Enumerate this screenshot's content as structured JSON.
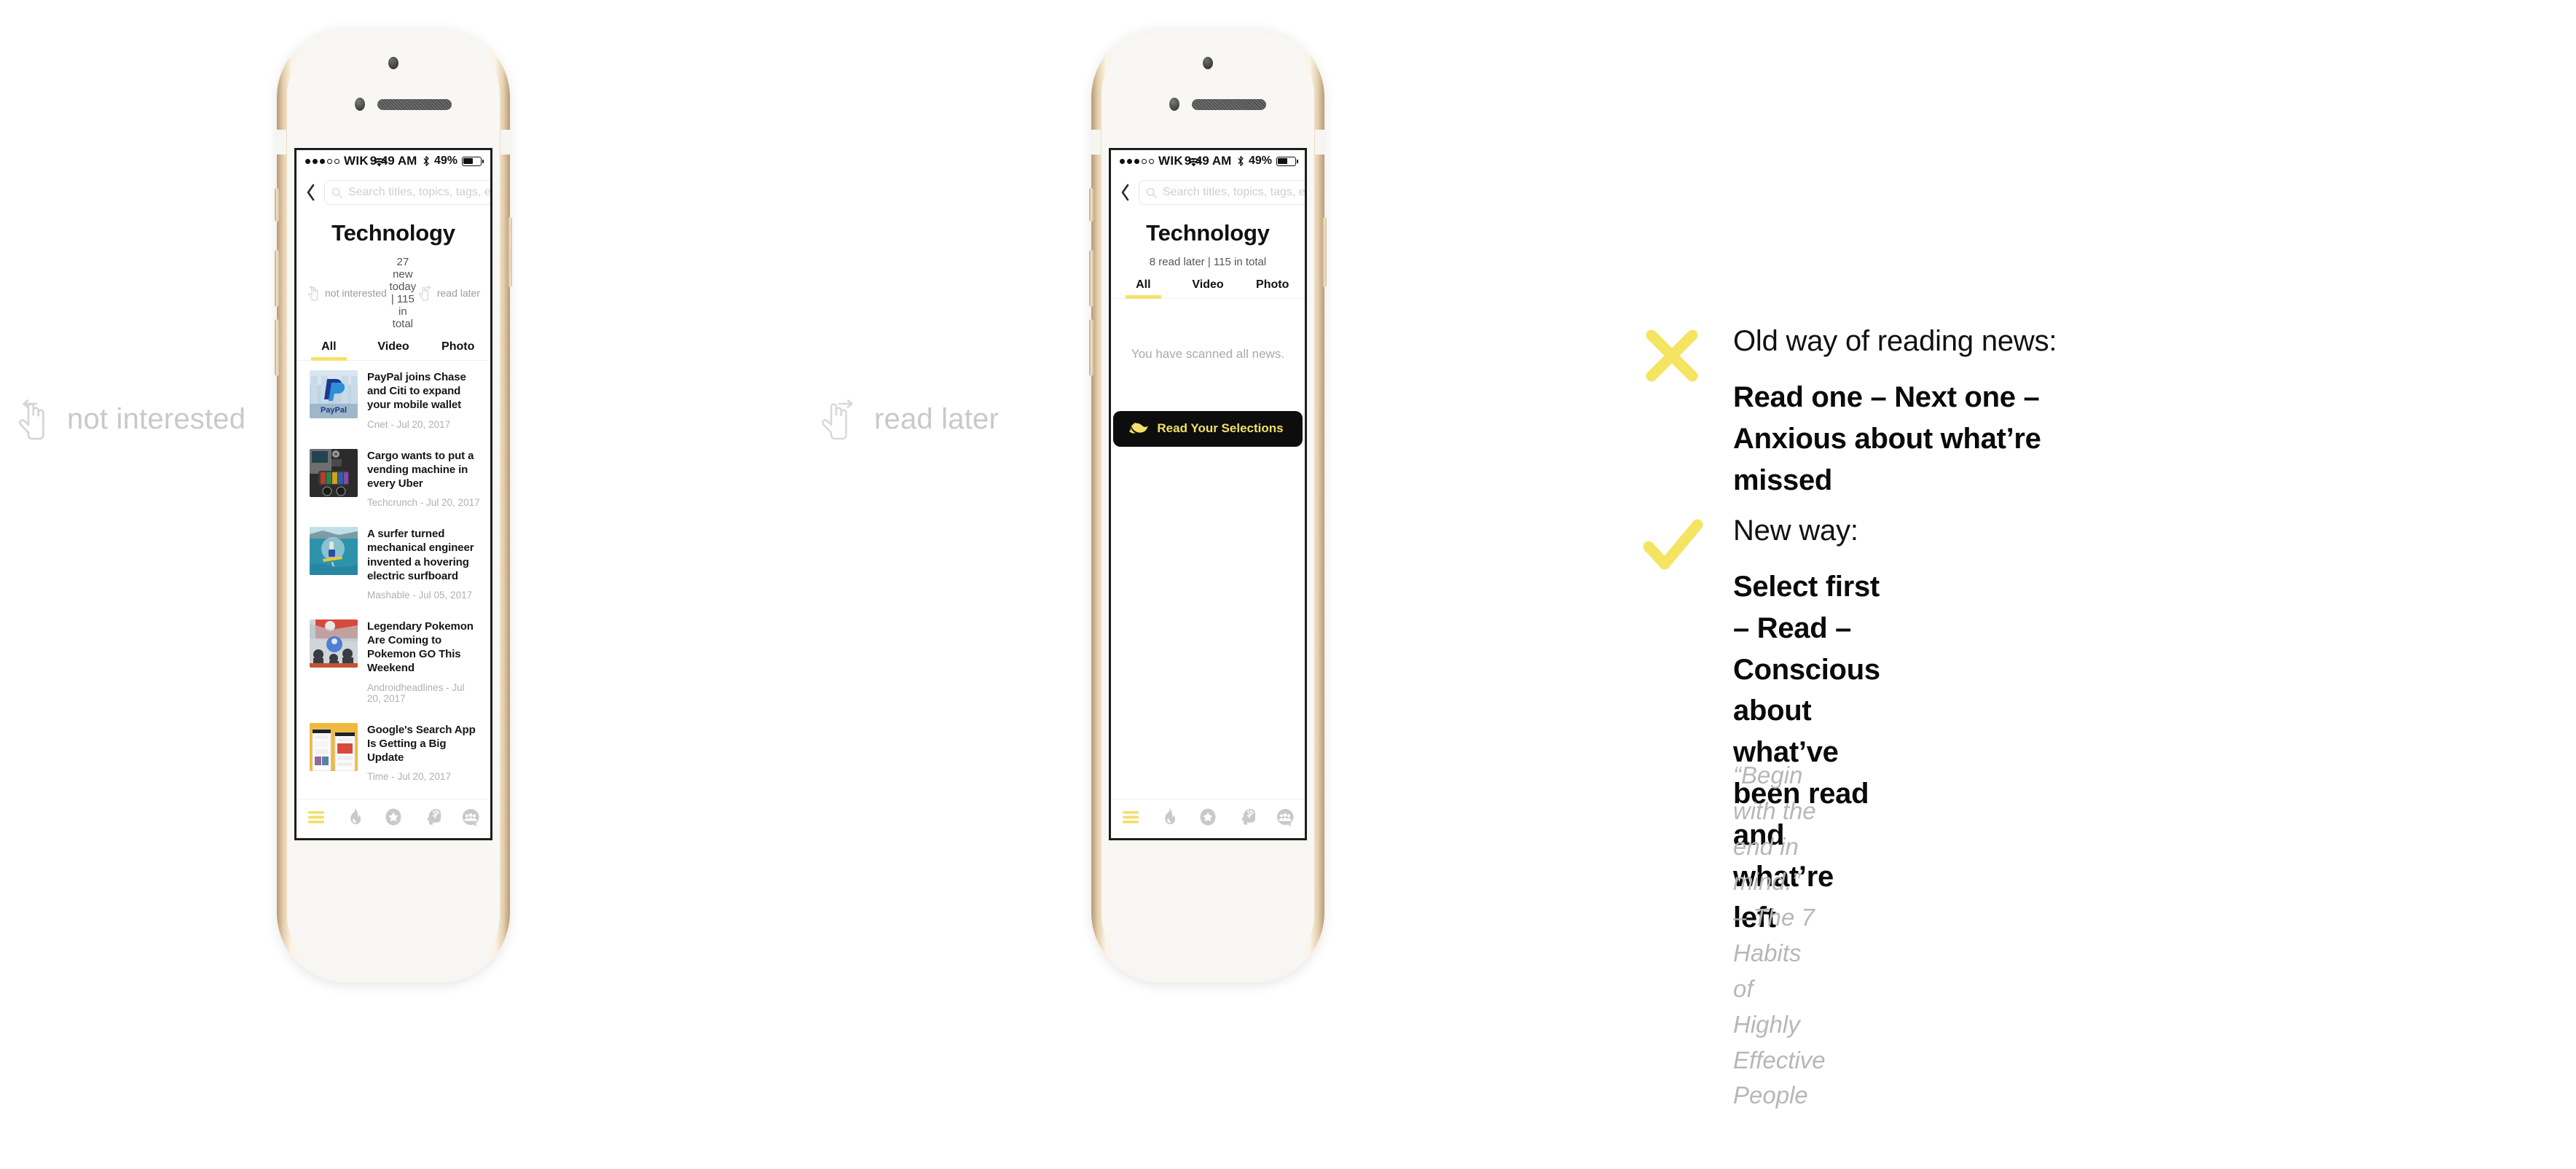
{
  "swipe_hints": [
    {
      "label": "not interested",
      "icon": "hand-swipe-left-icon",
      "direction": "left"
    },
    {
      "label": "read later",
      "icon": "hand-swipe-right-icon",
      "direction": "right"
    }
  ],
  "status_bar": {
    "carrier": "WIK",
    "signal_filled": 3,
    "signal_total": 5,
    "wifi_icon": "wifi-icon",
    "time": "9:49 AM",
    "bluetooth_icon": "bluetooth-icon",
    "battery_percent": "49%",
    "battery_level": 49
  },
  "search": {
    "back_icon": "chevron-left-icon",
    "magnifier_icon": "search-icon",
    "placeholder": "Search titles, topics, tags, etc.",
    "value": "",
    "clear_icon": "clear-circle-icon",
    "settings_icon": "gear-icon"
  },
  "phone_one": {
    "category_title": "Technology",
    "meta_left": "not interested",
    "meta_center": "27 new today | 115 in total",
    "meta_right": "read later",
    "tabs": [
      {
        "label": "All",
        "active": true
      },
      {
        "label": "Video",
        "active": false
      },
      {
        "label": "Photo",
        "active": false
      }
    ],
    "news": [
      {
        "title": "PayPal joins Chase and Citi to expand your mobile wallet",
        "source": "Cnet - Jul 20, 2017",
        "thumb": "paypal-logo-building"
      },
      {
        "title": "Cargo wants to put a vending machine in every Uber",
        "source": "Techcrunch - Jul 20, 2017",
        "thumb": "car-console-vending-box"
      },
      {
        "title": "A surfer turned mechanical engineer invented a hovering electric surfboard",
        "source": "Mashable - Jul 05, 2017",
        "thumb": "surfer-on-ocean"
      },
      {
        "title": "Legendary Pokemon Are Coming to Pokemon GO This Weekend",
        "source": "Androidheadlines - Jul 20, 2017",
        "thumb": "pokemon-go-event-crowd"
      },
      {
        "title": "Google's Search App Is Getting a Big Update",
        "source": "Time - Jul 20, 2017",
        "thumb": "google-app-phones-yellow"
      }
    ]
  },
  "phone_two": {
    "category_title": "Technology",
    "meta_center": "8 read later | 115 in total",
    "tabs": [
      {
        "label": "All",
        "active": true
      },
      {
        "label": "Video",
        "active": false
      },
      {
        "label": "Photo",
        "active": false
      }
    ],
    "empty_message": "You have scanned all news.",
    "cta_label": "Read Your Selections",
    "cta_icon": "reading-hand-book-icon"
  },
  "tabbar": [
    {
      "icon": "hamburger-menu-icon",
      "active": true
    },
    {
      "icon": "flame-icon",
      "active": false
    },
    {
      "icon": "star-circle-icon",
      "active": false
    },
    {
      "icon": "brain-head-icon",
      "active": false
    },
    {
      "icon": "community-speech-bubble-icon",
      "active": false
    }
  ],
  "copy": {
    "old_way": {
      "mark_icon": "cross-mark-icon",
      "heading": "Old way of reading news:",
      "statement": "Read one – Next one – Anxious about what’re missed"
    },
    "new_way": {
      "mark_icon": "check-mark-icon",
      "heading": "New way:",
      "statement_line1": "Select first – Read – Conscious about what’ve",
      "statement_line2": "been read and what’re left"
    },
    "quote_line1": "“Begin with the end in mind.”",
    "quote_line2": "– The 7 Habits of Highly Effective People"
  },
  "colors": {
    "accent_yellow": "#f5e26b",
    "cta_background": "#0d0d0d",
    "cta_text": "#f2e06a",
    "muted_gray": "#b0b0b0",
    "bezel_gold": "#d7bf9c"
  }
}
